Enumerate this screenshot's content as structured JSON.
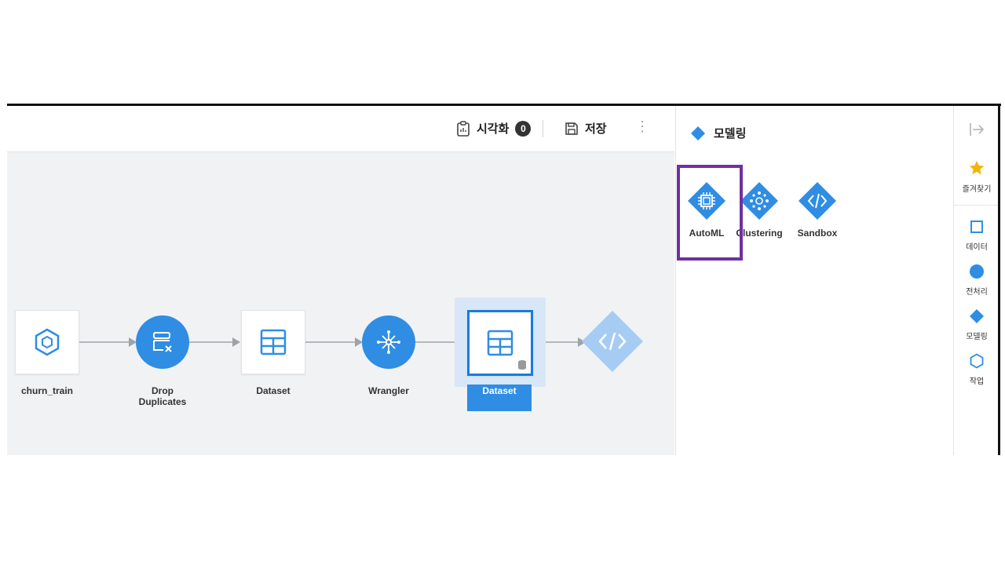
{
  "toolbar": {
    "visualize_label": "시각화",
    "visualize_count": "0",
    "save_label": "저장"
  },
  "pipeline": {
    "nodes": [
      {
        "label": "churn_train",
        "icon": "hexagon-icon"
      },
      {
        "label": "Drop\nDuplicates",
        "icon": "drop-duplicates-icon"
      },
      {
        "label": "Dataset",
        "icon": "table-icon"
      },
      {
        "label": "Wrangler",
        "icon": "wrangler-icon"
      },
      {
        "label": "Dataset",
        "icon": "table-db-icon",
        "selected": true
      },
      {
        "label": "",
        "icon": "code-diamond-icon"
      }
    ]
  },
  "panel": {
    "title": "모델링",
    "tools": [
      {
        "label": "AutoML",
        "icon": "chip-icon"
      },
      {
        "label": "Clustering",
        "icon": "cluster-icon"
      },
      {
        "label": "Sandbox",
        "icon": "code-icon"
      }
    ]
  },
  "rail": {
    "items": [
      {
        "label": "즐겨찾기",
        "icon": "star-icon"
      },
      {
        "label": "데이터",
        "icon": "square-icon"
      },
      {
        "label": "전처리",
        "icon": "circle-icon"
      },
      {
        "label": "모델링",
        "icon": "diamond-icon"
      },
      {
        "label": "작업",
        "icon": "hexagon-icon"
      }
    ]
  },
  "colors": {
    "accent": "#2f8de4",
    "highlight": "#7030a0",
    "star": "#f5b400",
    "canvas_bg": "#f1f2f4"
  }
}
